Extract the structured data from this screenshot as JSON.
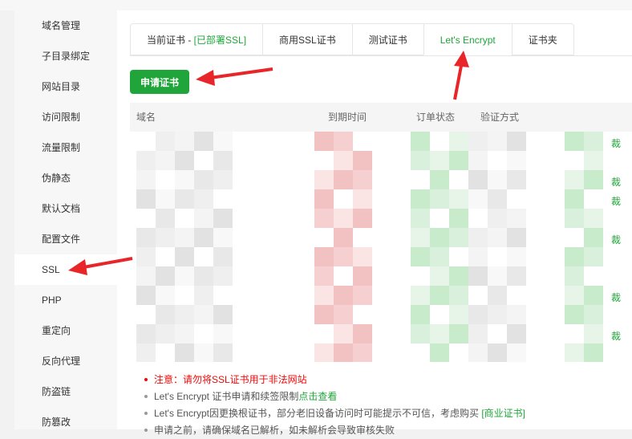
{
  "sidebar": {
    "items": [
      {
        "label": "域名管理",
        "active": false
      },
      {
        "label": "子目录绑定",
        "active": false
      },
      {
        "label": "网站目录",
        "active": false
      },
      {
        "label": "访问限制",
        "active": false
      },
      {
        "label": "流量限制",
        "active": false
      },
      {
        "label": "伪静态",
        "active": false
      },
      {
        "label": "默认文档",
        "active": false
      },
      {
        "label": "配置文件",
        "active": false
      },
      {
        "label": "SSL",
        "active": true
      },
      {
        "label": "PHP",
        "active": false
      },
      {
        "label": "重定向",
        "active": false
      },
      {
        "label": "反向代理",
        "active": false
      },
      {
        "label": "防盗链",
        "active": false
      },
      {
        "label": "防篡改",
        "active": false
      }
    ]
  },
  "tabs": {
    "current_prefix": "当前证书 - ",
    "current_status": "[已部署SSL]",
    "commercial": "商用SSL证书",
    "test": "测试证书",
    "letsencrypt": "Let's Encrypt",
    "folder": "证书夹",
    "active": "letsencrypt"
  },
  "apply_button": "申请证书",
  "table": {
    "headers": {
      "domain": "域名",
      "expire": "到期时间",
      "order_status": "订单状态",
      "verify_method": "验证方式"
    },
    "action_glyph": "裁"
  },
  "notes": [
    {
      "text": "注意：请勿将SSL证书用于非法网站",
      "type": "warning"
    },
    {
      "text": "Let's Encrypt 证书申请和续签限制",
      "link": "点击查看",
      "type": "normal"
    },
    {
      "text": "Let's Encrypt因更换根证书，部分老旧设备访问时可能提示不可信，考虑购买 ",
      "link": "[商业证书]",
      "type": "normal"
    },
    {
      "text": "申请之前，请确保域名已解析，如未解析会导致审核失败",
      "type": "normal"
    }
  ],
  "colors": {
    "accent": "#20a53a",
    "warning": "#ef0808",
    "arrow": "#e8262a"
  }
}
